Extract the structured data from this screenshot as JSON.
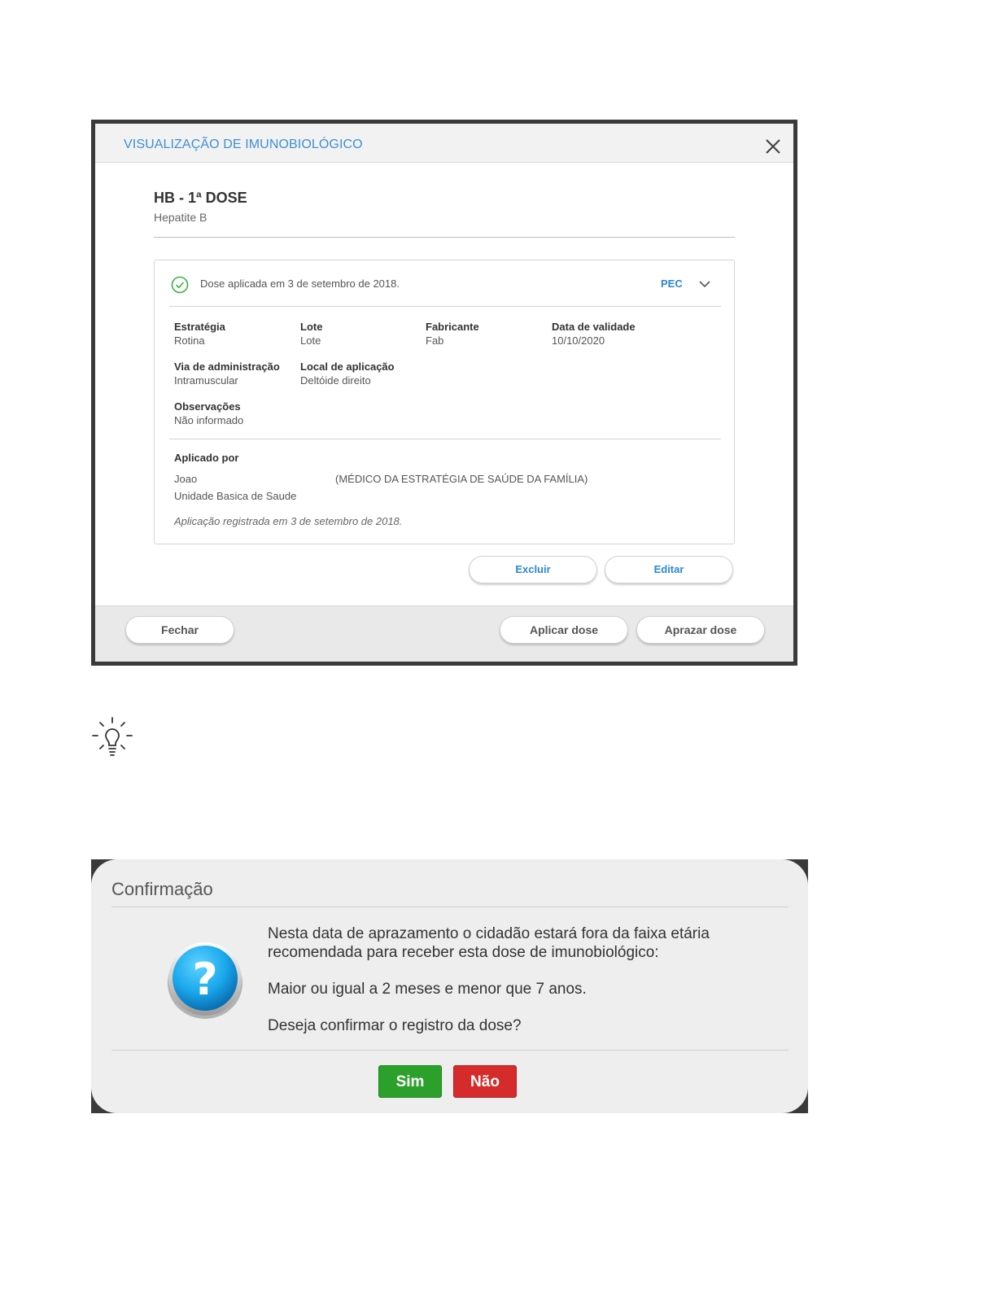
{
  "modal": {
    "title": "VISUALIZAÇÃO DE IMUNOBIOLÓGICO",
    "vaccine_title": "HB - 1ª DOSE",
    "vaccine_name": "Hepatite B",
    "card": {
      "status_text": "Dose aplicada em 3 de setembro de 2018.",
      "source_label": "PEC",
      "fields": {
        "strategy": {
          "label": "Estratégia",
          "value": "Rotina"
        },
        "lot": {
          "label": "Lote",
          "value": "Lote"
        },
        "manufacturer": {
          "label": "Fabricante",
          "value": "Fab"
        },
        "expiry": {
          "label": "Data de validade",
          "value": "10/10/2020"
        },
        "route": {
          "label": "Via de administração",
          "value": "Intramuscular"
        },
        "site": {
          "label": "Local de aplicação",
          "value": "Deltóide direito"
        },
        "notes": {
          "label": "Observações",
          "value": "Não informado"
        }
      },
      "applied_by_label": "Aplicado por",
      "professional_name": "Joao",
      "professional_role": "(MÉDICO DA ESTRATÉGIA DE SAÚDE DA FAMÍLIA)",
      "unit_name": "Unidade Basica de Saude",
      "registered_note": "Aplicação registrada em 3 de setembro de 2018."
    },
    "actions": {
      "delete": "Excluir",
      "edit": "Editar"
    },
    "footer": {
      "close": "Fechar",
      "apply": "Aplicar dose",
      "schedule": "Aprazar dose"
    }
  },
  "confirm": {
    "title": "Confirmação",
    "line1": "Nesta data de aprazamento o cidadão estará fora da faixa etária",
    "line2": "recomendada para receber esta dose de imunobiológico:",
    "range": "Maior ou igual a 2 meses e menor que 7 anos.",
    "question": "Deseja confirmar o registro da dose?",
    "yes": "Sim",
    "no": "Não"
  },
  "colors": {
    "accent_blue": "#2b86d6",
    "check_green": "#3cb043",
    "yes_green": "#2ba02b",
    "no_red": "#d62b2b"
  },
  "icons": {
    "close": "close-icon",
    "check": "check-circle-icon",
    "chevron": "chevron-down-icon",
    "bulb": "lightbulb-icon",
    "question": "question-icon"
  }
}
